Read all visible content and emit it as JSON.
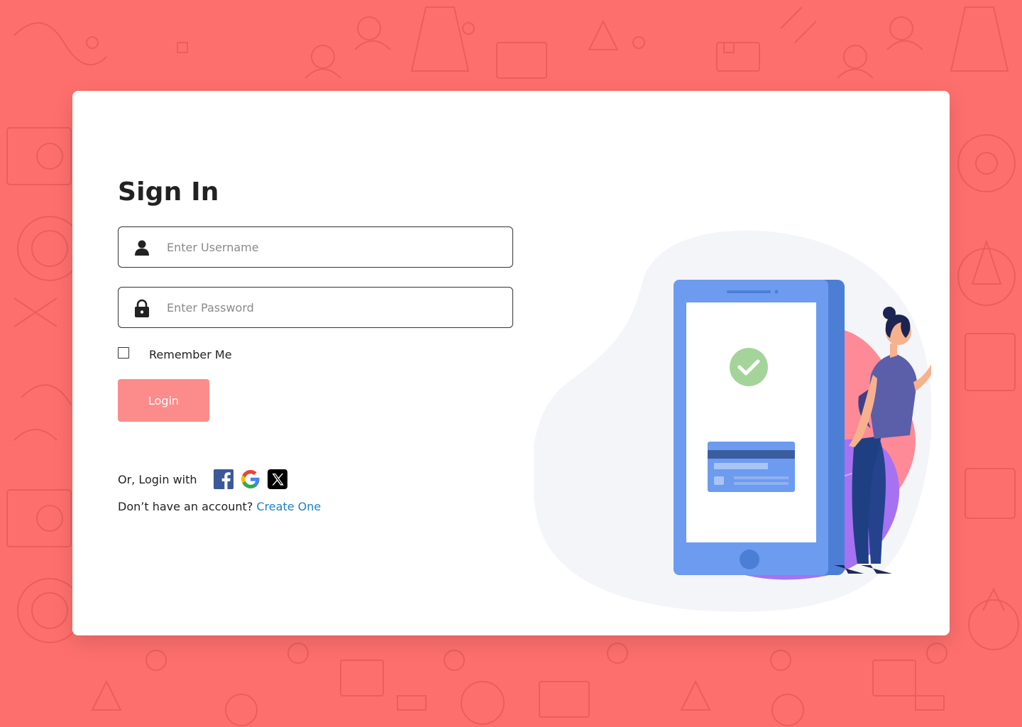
{
  "signin": {
    "title": "Sign In",
    "username": {
      "placeholder": "Enter Username",
      "value": "",
      "icon": "user-icon"
    },
    "password": {
      "placeholder": "Enter Password",
      "value": "",
      "icon": "lock-icon"
    },
    "remember_label": "Remember Me",
    "remember_checked": false,
    "login_label": "Login",
    "social_label": "Or, Login with",
    "social": [
      "facebook-icon",
      "google-icon",
      "x-icon"
    ],
    "signup_prompt": "Don’t have an account?",
    "signup_link": "Create One"
  },
  "colors": {
    "background": "#fd6f6d",
    "card": "#ffffff",
    "login_button": "#fc8b8b",
    "link": "#1a82c7",
    "phone": "#6c9bf0",
    "check": "#a4d49a"
  }
}
